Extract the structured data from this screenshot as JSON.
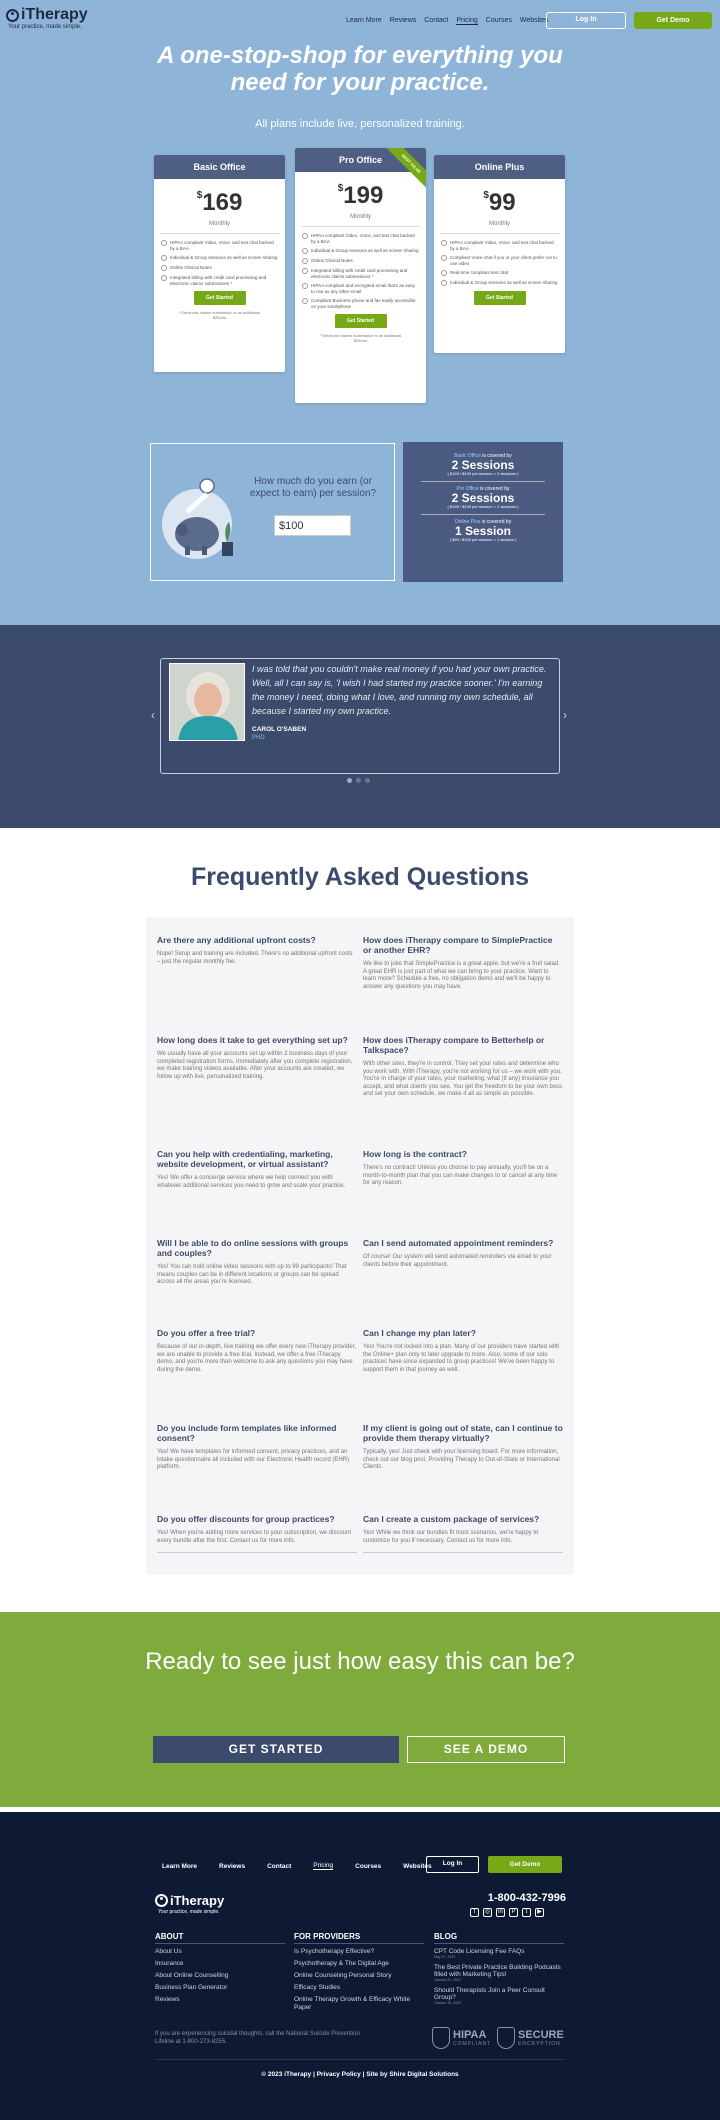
{
  "brand": {
    "name": "iTherapy",
    "tagline": "Your practice, made simple."
  },
  "nav": {
    "items": [
      "Learn More",
      "Reviews",
      "Contact",
      "Pricing",
      "Courses",
      "Websites"
    ],
    "active": "Pricing",
    "login": "Log In",
    "demo": "Get Demo"
  },
  "hero": {
    "title": "A one-stop-shop for everything you need for your practice.",
    "subtitle": "All plans include live, personalized training."
  },
  "plans": [
    {
      "name": "Basic Office",
      "currency": "$",
      "price": "169",
      "period": "Monthly",
      "features": [
        "HIPAA compliant Video, Voice, and text chat backed by a BAA",
        "Individual & Group sessions as well as screen sharing",
        "Online Clinical Notes",
        "Integrated billing with credit card processing and electronic claims submissions *"
      ],
      "cta": "Get Started",
      "note": "* Electronic claims submission is an additional $25/mo"
    },
    {
      "name": "Pro Office",
      "currency": "$",
      "price": "199",
      "period": "Monthly",
      "ribbon": "BEST VALUE",
      "features": [
        "HIPAA compliant Video, Voice, and text chat backed by a BAA",
        "Individual & Group sessions as well as screen sharing",
        "Online Clinical Notes",
        "Integrated billing with credit card processing and electronic claims submissions *",
        "HIPAA compliant and encrypted email that's as easy to use as any other email",
        "Compliant Business phone and fax easily accessible on your smartphone"
      ],
      "cta": "Get Started",
      "note": "* Electronic claims submission is an additional $25/mo"
    },
    {
      "name": "Online Plus",
      "currency": "$",
      "price": "99",
      "period": "Monthly",
      "features": [
        "HIPAA compliant Video, Voice, and text chat backed by a BAA",
        "Compliant Voice chat if you or your client prefer not to use video",
        "Real-time compliant text chat",
        "Individual & Group sessions as well as screen sharing"
      ],
      "cta": "Get Started"
    }
  ],
  "calculator": {
    "question": "How much do you earn (or expect to earn) per session?",
    "value": "$100"
  },
  "sessions": [
    {
      "plan": "Basic Office",
      "covered": " is covered by",
      "count": "2 Sessions",
      "calc": "( $169 / $100 per session = 2 sessions )"
    },
    {
      "plan": "Pro Office",
      "covered": " is covered by",
      "count": "2 Sessions",
      "calc": "( $199 / $100 per session = 2 sessions )"
    },
    {
      "plan": "Online Plus",
      "covered": " is covered by",
      "count": "1 Session",
      "calc": "( $99 / $100 per session = 1 session )"
    }
  ],
  "testimonial": {
    "quote": "I was told that you couldn't make real money if you had your own practice. Well, all I can say is, 'I wish I had started my practice sooner.' I'm earning the money I need, doing what I love, and running my own schedule, all because I started my own practice.",
    "name": "CAROL O'SABEN",
    "role": "PHD"
  },
  "faq": {
    "title": "Frequently Asked Questions",
    "items": [
      {
        "q": "Are there any additional upfront costs?",
        "a": "Nope! Setup and training are included. There's no additional upfront costs – just the regular monthly fee."
      },
      {
        "q": "How does iTherapy compare to SimplePractice or another EHR?",
        "a": "We like to joke that SimplePractice is a great apple, but we're a fruit salad. A great EHR is just part of what we can bring to your practice. Want to learn more? Schedule a free, no obligation demo and we'll be happy to answer any questions you may have."
      },
      {
        "q": "How long does it take to get everything set up?",
        "a": "We usually have all your accounts set up within 2 business days of your completed registration forms. Immediately after you complete registration, we make training videos available. After your accounts are created, we follow up with live, personalized training."
      },
      {
        "q": "How does iTherapy compare to Betterhelp or Talkspace?",
        "a": "With other sites, they're in control. They set your rates and determine who you work with. With iTherapy, you're not working for us – we work with you. You're in charge of your rates, your marketing, what (if any) insurance you accept, and what clients you see. You get the freedom to be your own boss and set your own schedule, we make it all as simple as possible."
      },
      {
        "q": "Can you help with credentialing, marketing, website development, or virtual assistant?",
        "a": "Yes! We offer a concierge service where we help connect you with whatever additional services you need to grow and scale your practice."
      },
      {
        "q": "How long is the contract?",
        "a": "There's no contract! Unless you choose to pay annually, you'll be on a month-to-month plan that you can make changes to or cancel at any time for any reason."
      },
      {
        "q": "Will I be able to do online sessions with groups and couples?",
        "a": "Yes! You can hold online video sessions with up to 99 participants! That means couples can be in different locations or groups can be spread across all the areas you're licensed."
      },
      {
        "q": "Can I send automated appointment reminders?",
        "a": "Of course! Our system will send automated reminders via email to your clients before their appointment."
      },
      {
        "q": "Do you offer a free trial?",
        "a": "Because of our in-depth, live training we offer every new iTherapy provider, we are unable to provide a free trial. Instead, we offer a free iTherapy demo, and you're more than welcome to ask any questions you may have during the demo."
      },
      {
        "q": "Can I change my plan later?",
        "a": "Yes! You're not locked into a plan. Many of our providers have started with the Online+ plan only to later upgrade to more. Also, some of our solo practices have since expanded to group practices! We've been happy to support them in that journey as well."
      },
      {
        "q": "Do you include form templates like informed consent?",
        "a": "Yes! We have templates for informed consent, privacy practices, and an intake questionnaire all included with our Electronic Health record (EHR) platform."
      },
      {
        "q": "If my client is going out of state, can I continue to provide them therapy virtually?",
        "a": "Typically, yes! Just check with your licensing board. For more information, check out our blog post, Providing Therapy to Out-of-State or International Clients."
      },
      {
        "q": "Do you offer discounts for group practices?",
        "a": "Yes! When you're adding more services to your subscription, we discount every bundle after the first. Contact us for more info."
      },
      {
        "q": "Can I create a custom package of services?",
        "a": "Yes! While we think our bundles fit most scenarios, we're happy to customize for you if necessary. Contact us for more info."
      }
    ]
  },
  "cta": {
    "title": "Ready to see just how easy this can be?",
    "primary": "GET STARTED",
    "secondary": "SEE A DEMO"
  },
  "footer": {
    "nav": [
      "Learn More",
      "Reviews",
      "Contact",
      "Pricing",
      "Courses",
      "Websites"
    ],
    "active": "Pricing",
    "login": "Log In",
    "demo": "Get Demo",
    "phone": "1-800-432-7996",
    "socials": [
      "facebook-icon",
      "instagram-icon",
      "linkedin-icon",
      "pinterest-icon",
      "twitter-icon",
      "youtube-icon"
    ],
    "about": {
      "title": "ABOUT",
      "items": [
        "About Us",
        "Insurance",
        "About Online Counselling",
        "Business Plan Generator",
        "Reviews"
      ]
    },
    "providers": {
      "title": "FOR PROVIDERS",
      "items": [
        "Is Psychotherapy Effective?",
        "Psychotherapy & The Digital Age",
        "Online Counseling Personal Story",
        "Efficacy Studies",
        "Online Therapy Growth & Efficacy White Paper"
      ]
    },
    "blog": {
      "title": "BLOG",
      "items": [
        {
          "title": "CPT Code Licensing Fee FAQs",
          "date": "May 27, 2023"
        },
        {
          "title": "The Best Private Practice Building Podcasts filled with Marketing Tips!",
          "date": "January 20, 2021"
        },
        {
          "title": "Should Therapists Join a Peer Consult Group?",
          "date": "October 15, 2020"
        }
      ]
    },
    "suicide": "If you are experiencing suicidal thoughts, call the National Suicide Prevention Lifeline at 1-800-273-8255.",
    "badge1": {
      "title": "HIPAA",
      "sub": "COMPLIANT"
    },
    "badge2": {
      "title": "SECURE",
      "sub": "ENCRYPTION"
    },
    "copyright": "© 2023 iTherapy | Privacy Policy | Site by Shire Digital Solutions"
  },
  "colors": {
    "accent_green": "#76a817",
    "navy": "#3c4b6b",
    "hero_blue": "#8eb4d8",
    "footer_bg": "#0e1a33"
  }
}
